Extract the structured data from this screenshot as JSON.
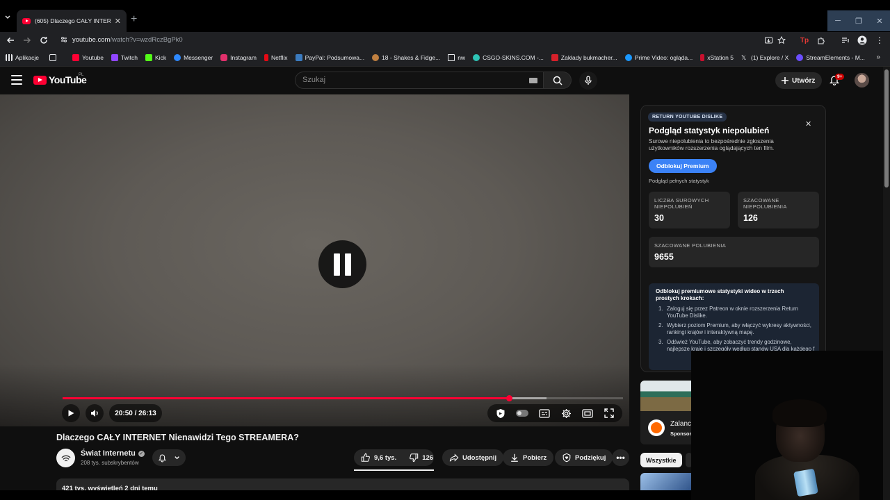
{
  "browser": {
    "tab_title": "(605) Dlaczego CAŁY INTERNET",
    "url_main": "youtube.com",
    "url_path": "/watch?v=wzdRczBgPk0",
    "bookmarks": [
      {
        "label": "Aplikacje",
        "color": "#e8eaed"
      },
      {
        "label": "Youtube",
        "color": "#ff0033"
      },
      {
        "label": "Twitch",
        "color": "#9146ff"
      },
      {
        "label": "Kick",
        "color": "#53fc18"
      },
      {
        "label": "Messenger",
        "color": "#2e89ff"
      },
      {
        "label": "Instagram",
        "color": "#e1306c"
      },
      {
        "label": "Netflix",
        "color": "#e50914"
      },
      {
        "label": "PayPal: Podsumowa...",
        "color": "#3b7bbf"
      },
      {
        "label": "18 - Shakes & Fidge...",
        "color": "#c08040"
      },
      {
        "label": "nw",
        "color": "#202124"
      },
      {
        "label": "CSGO-SKINS.COM -...",
        "color": "#2ec4b6"
      },
      {
        "label": "Zakłady bukmacher...",
        "color": "#d6202a"
      },
      {
        "label": "Prime Video: ogląda...",
        "color": "#1a98ff"
      },
      {
        "label": "xStation 5",
        "color": "#c8102e"
      },
      {
        "label": "(1) Explore / X",
        "color": "#e8eaed"
      },
      {
        "label": "StreamElements - M...",
        "color": "#6b4eff"
      }
    ]
  },
  "masthead": {
    "logo_text": "YouTube",
    "country_code": "PL",
    "search_placeholder": "Szukaj",
    "create_label": "Utwórz",
    "notif_count": "9+"
  },
  "player": {
    "time": "20:50 / 26:13",
    "progress": 0.7966,
    "buffered": 0.8635
  },
  "video": {
    "title": "Dlaczego CAŁY INTERNET Nienawidzi Tego STREAMERA?",
    "channel": "Świat Internetu",
    "subscribers": "208 tys. subskrybentów",
    "likes": "9,6 tys.",
    "dislikes": "126",
    "share_label": "Udostępnij",
    "download_label": "Pobierz",
    "thanks_label": "Podziękuj",
    "views_line": "421 tys. wyświetleń  2 dni temu"
  },
  "ryd": {
    "badge": "RETURN YOUTUBE DISLIKE",
    "title": "Podgląd statystyk niepolubień",
    "subtitle": "Surowe niepolubienia to bezpośrednie zgłoszenia użytkowników rozszerzenia oglądających ten film.",
    "unlock_button": "Odblokuj Premium",
    "note": "Podgląd pełnych statystyk",
    "stats": [
      {
        "label": "LICZBA SUROWYCH NIEPOLUBIEŃ",
        "value": "30"
      },
      {
        "label": "SZACOWANE NIEPOLUBIENIA",
        "value": "126"
      },
      {
        "label": "SZACOWANE POLUBIENIA",
        "value": "9655"
      }
    ],
    "promo_title": "Odblokuj premiumowe statystyki wideo w trzech prostych krokach:",
    "promo_steps": [
      {
        "n": "1.",
        "text": "Zaloguj się przez Patreon w oknie rozszerzenia Return YouTube Dislike."
      },
      {
        "n": "2.",
        "text": "Wybierz poziom Premium, aby włączyć wykresy aktywności, rankingi krajów i interaktywną mapę."
      },
      {
        "n": "3.",
        "text": "Odśwież YouTube, aby zobaczyć trendy godzinowe, najlepsze kraje i szczegóły według stanów USA dla każdego f"
      }
    ]
  },
  "sidebar": {
    "ad_name": "Zalanc",
    "ad_sponsored": "Sponsor",
    "chip_all": "Wszystkie"
  }
}
